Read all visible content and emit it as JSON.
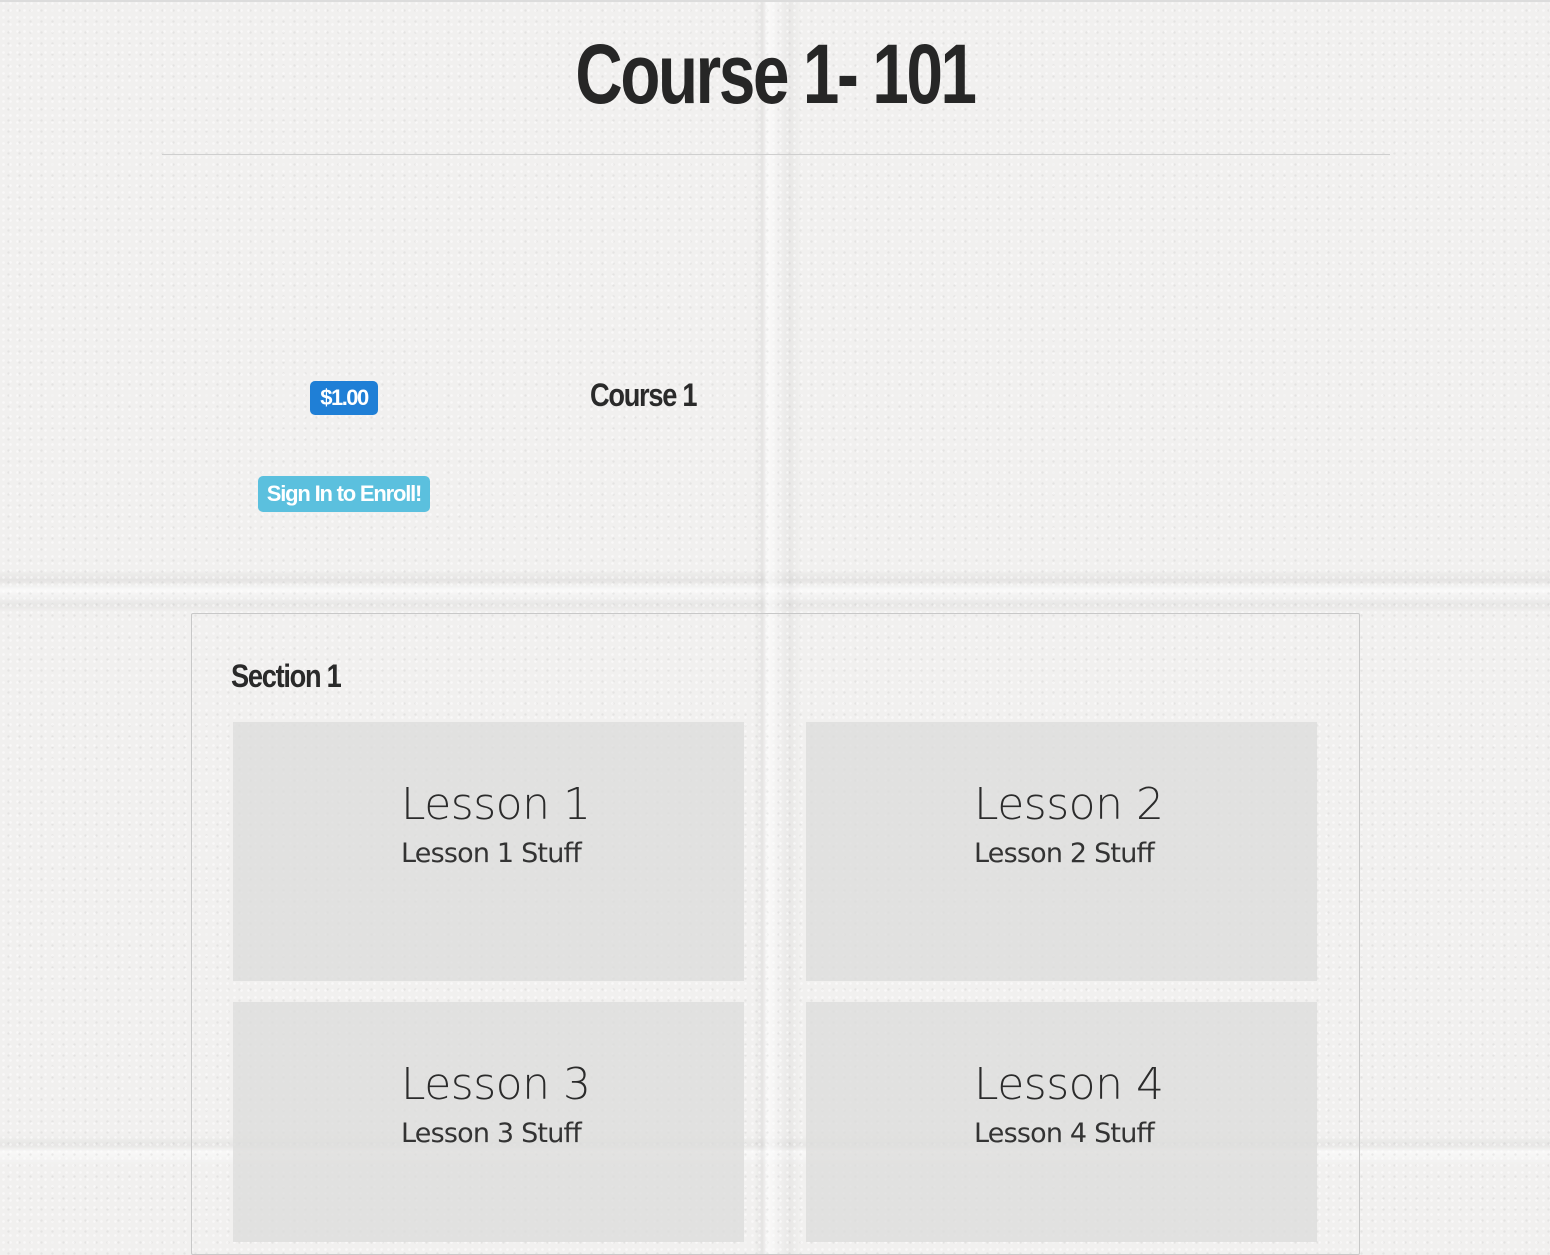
{
  "course": {
    "title": "Course 1- 101",
    "name": "Course 1",
    "price": "$1.00",
    "enroll_label": "Sign In to Enroll!"
  },
  "section": {
    "title": "Section 1",
    "lessons": [
      {
        "title": "Lesson 1",
        "description": "Lesson 1 Stuff"
      },
      {
        "title": "Lesson 2",
        "description": "Lesson 2 Stuff"
      },
      {
        "title": "Lesson 3",
        "description": "Lesson 3 Stuff"
      },
      {
        "title": "Lesson 4",
        "description": "Lesson 4 Stuff"
      }
    ]
  },
  "colors": {
    "price_badge": "#1f7fd6",
    "enroll_button": "#5bc0de",
    "heading_text": "#262626",
    "lesson_card": "#dddcdb"
  }
}
